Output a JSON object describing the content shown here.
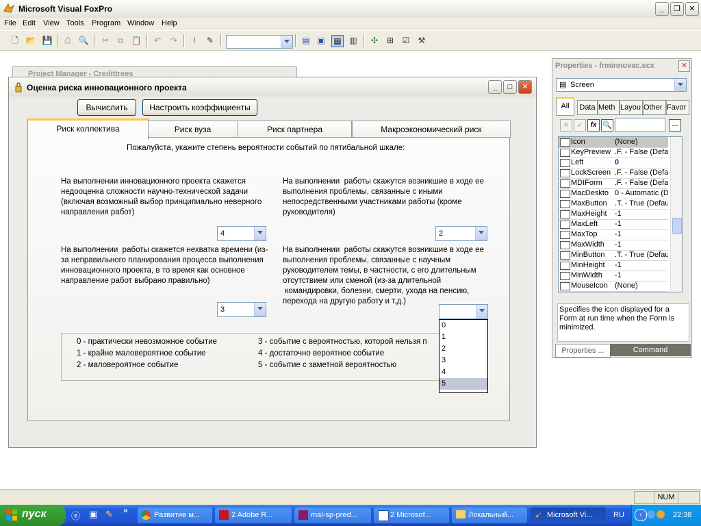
{
  "app": {
    "title": "Microsoft Visual FoxPro"
  },
  "menu": [
    "File",
    "Edit",
    "View",
    "Tools",
    "Program",
    "Window",
    "Help"
  ],
  "project_manager": {
    "title": "Project Manager - Credittrees"
  },
  "form": {
    "title": "Оценка риска инновационного проекта",
    "buttons": {
      "calculate": "Вычислить",
      "configure": "Настроить коэффициенты"
    },
    "tabs": [
      "Риск коллектива",
      "Риск вуза",
      "Риск партнера",
      "Макроэкономический риск"
    ],
    "instruction": "Пожалуйста, укажите степень вероятности событий по пятибальной шкале:",
    "questions": [
      {
        "text": "На выполнении инновационного проекта скажется недооценка сложности научно-технической задачи (включая возможный выбор принципиально неверного направления работ)",
        "value": "4"
      },
      {
        "text": "На выполнении  работы скажутся возникшие в ходе ее выполнения проблемы, связанные с иными непосредственными участниками работы (кроме руководителя)",
        "value": "2"
      },
      {
        "text": "На выполнении  работы скажется нехватка времени (из-за неправильного планирования процесса выполнения инновационного проекта, в то время как основное направление работ выбрано правильно)",
        "value": "3"
      },
      {
        "text": "На выполнении  работы скажутся возникшие в ходе ее выполнения проблемы, связанные с научным руководителем темы, в частности, с его длительным отсутствием или сменой (из-за длительной\n командировки, болезни, смерти, ухода на пенсию, перехода на другую работу и т.д.)",
        "value": ""
      }
    ],
    "dropdown_options": [
      "0",
      "1",
      "2",
      "3",
      "4",
      "5"
    ],
    "dropdown_highlighted": "5",
    "legend": [
      "0 - практически невозможное событие",
      "1 - крайне маловероятное событие",
      "2 - маловероятное событие",
      "3 - событие с вероятностью, которой нельзя п",
      "4 - достаточно вероятное событие",
      "5 - событие с заметной вероятностью"
    ]
  },
  "properties": {
    "title": "Properties - frminnovac.scx",
    "object": "Screen",
    "tabs": [
      "All",
      "Data",
      "Meth",
      "Layou",
      "Other",
      "Favor"
    ],
    "rows": [
      {
        "name": "Icon",
        "value": "(None)"
      },
      {
        "name": "KeyPreview",
        "value": ".F. - False (Defau"
      },
      {
        "name": "Left",
        "value": "0"
      },
      {
        "name": "LockScreen",
        "value": ".F. - False (Defau"
      },
      {
        "name": "MDIForm",
        "value": ".F. - False (Defau"
      },
      {
        "name": "MacDeskto",
        "value": "0 - Automatic (De"
      },
      {
        "name": "MaxButton",
        "value": ".T. - True (Defau"
      },
      {
        "name": "MaxHeight",
        "value": "-1"
      },
      {
        "name": "MaxLeft",
        "value": "-1"
      },
      {
        "name": "MaxTop",
        "value": "-1"
      },
      {
        "name": "MaxWidth",
        "value": "-1"
      },
      {
        "name": "MinButton",
        "value": ".T. - True (Defau"
      },
      {
        "name": "MinHeight",
        "value": "-1"
      },
      {
        "name": "MinWidth",
        "value": "-1"
      },
      {
        "name": "MouseIcon",
        "value": "(None)"
      }
    ],
    "description": "Specifies the icon displayed for a Form at run time when the Form is minimized.",
    "bottom_tabs": [
      "Properties ...",
      "Command"
    ]
  },
  "status": {
    "num": "NUM"
  },
  "taskbar": {
    "start": "пуск",
    "tasks": [
      "Развитие м...",
      "2 Adobe R...",
      "mal-sp-pred...",
      "2 Microsof...",
      "Локальный...",
      "Microsoft Vi..."
    ],
    "lang": "RU",
    "time": "22:38"
  }
}
